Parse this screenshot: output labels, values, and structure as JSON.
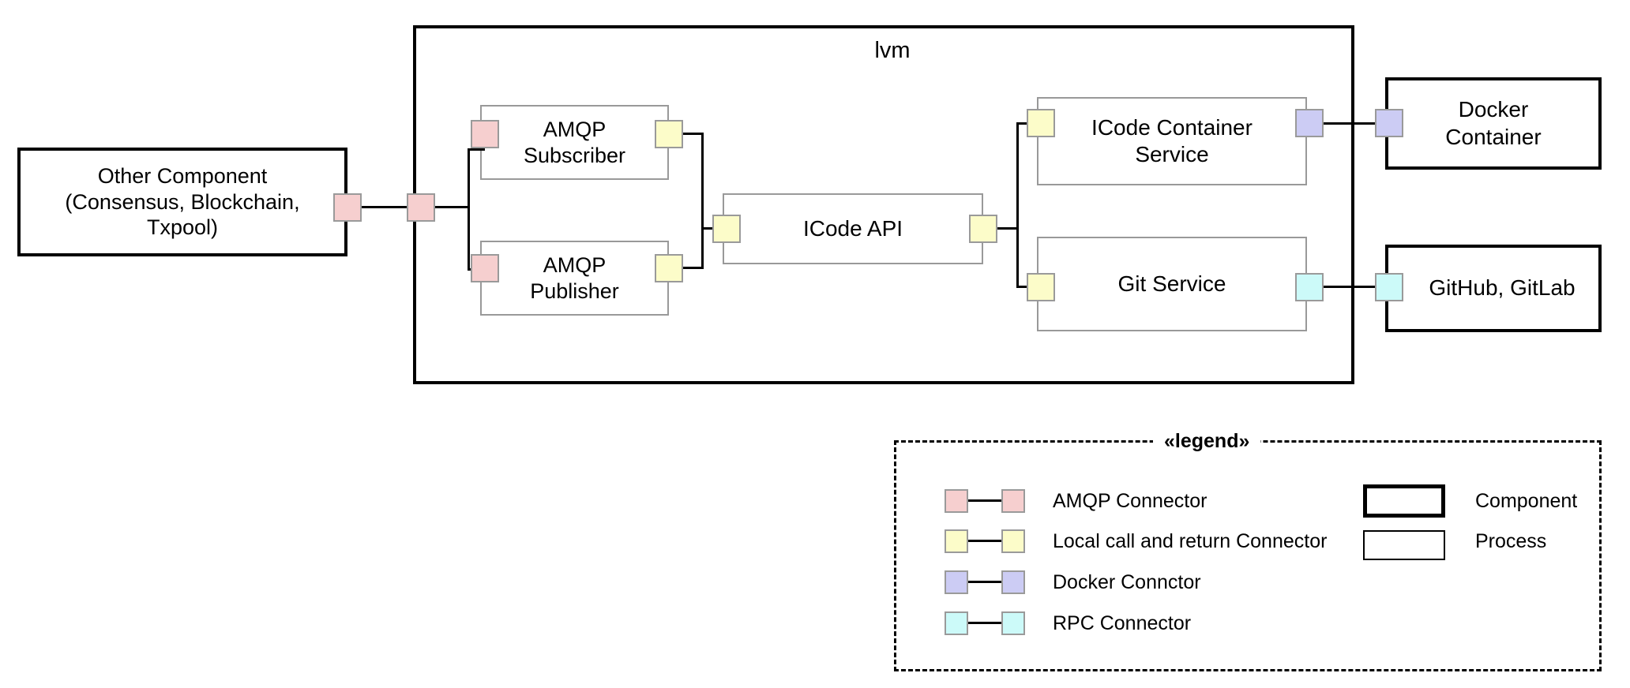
{
  "diagram": {
    "container": {
      "label": "lvm"
    },
    "nodes": {
      "other_component": {
        "label": "Other Component\n(Consensus, Blockchain,\nTxpool)",
        "type": "component"
      },
      "amqp_subscriber": {
        "label": "AMQP\nSubscriber",
        "type": "process"
      },
      "amqp_publisher": {
        "label": "AMQP\nPublisher",
        "type": "process"
      },
      "icode_api": {
        "label": "ICode API",
        "type": "process"
      },
      "icode_container_service": {
        "label": "ICode Container\nService",
        "type": "process"
      },
      "git_service": {
        "label": "Git Service",
        "type": "process"
      },
      "docker_container": {
        "label": "Docker\nContainer",
        "type": "component"
      },
      "github_gitlab": {
        "label": "GitHub, GitLab",
        "type": "component"
      }
    },
    "connector_colors": {
      "amqp": "#f6cfcf",
      "local": "#fcfcc9",
      "docker": "#ccccf4",
      "rpc": "#ccfaf9"
    }
  },
  "legend": {
    "title": "«legend»",
    "connectors": [
      {
        "name": "amqp",
        "label": "AMQP Connector"
      },
      {
        "name": "local",
        "label": "Local call and return Connector"
      },
      {
        "name": "docker",
        "label": "Docker Connctor"
      },
      {
        "name": "rpc",
        "label": "RPC Connector"
      }
    ],
    "shapes": [
      {
        "name": "component",
        "label": "Component"
      },
      {
        "name": "process",
        "label": "Process"
      }
    ]
  }
}
